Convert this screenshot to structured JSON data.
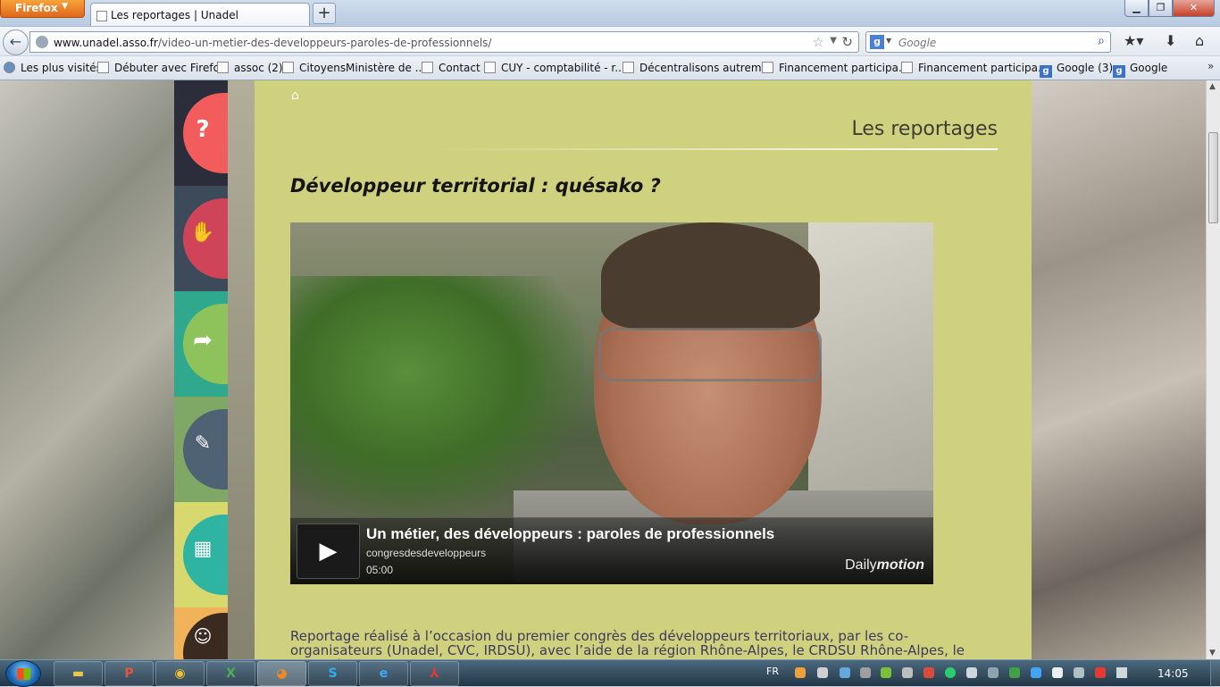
{
  "browser": {
    "app_button": "Firefox",
    "tab_title": "Les reportages | Unadel",
    "new_tab": "+",
    "url_host": "www.unadel.asso.fr",
    "url_path": "/video-un-metier-des-developpeurs-paroles-de-professionnels/",
    "search_placeholder": "Google"
  },
  "bookmarks": [
    {
      "label": "Les plus visités"
    },
    {
      "label": "Débuter avec Firefox"
    },
    {
      "label": "assoc (2)"
    },
    {
      "label": "Citoyens"
    },
    {
      "label": "Ministère de ..."
    },
    {
      "label": "Contact"
    },
    {
      "label": "CUY - comptabilité - r..."
    },
    {
      "label": "Décentralisons autrem..."
    },
    {
      "label": "Financement participa..."
    },
    {
      "label": "Financement participa..."
    },
    {
      "label": "Google (3)"
    },
    {
      "label": "Google"
    }
  ],
  "page": {
    "section_title": "Les reportages",
    "headline": "Développeur territorial : quésako ?",
    "video": {
      "title": "Un métier, des développeurs : paroles de professionnels",
      "channel": "congresdesdeveloppeurs",
      "duration": "05:00",
      "logo_prefix": "Daily",
      "logo_suffix": "motion"
    },
    "paragraph": "Reportage réalisé à l’occasion du premier congrès des développeurs territoriaux, par les co-organisateurs (Unadel, CVC, IRDSU), avec l’aide de la région Rhône-Alpes, le CRDSU Rhône-Alpes, le CRDR, le CIEDEL et"
  },
  "sidebar_tiles": [
    {
      "icon": "question-icon",
      "color": "#f25c5c"
    },
    {
      "icon": "handshake-icon",
      "color": "#d04459"
    },
    {
      "icon": "arrow-icon",
      "color": "#8ec25b"
    },
    {
      "icon": "document-icon",
      "color": "#4f6273"
    },
    {
      "icon": "calendar-icon",
      "color": "#2fb4a1"
    },
    {
      "icon": "people-icon",
      "color": "#3a2a20"
    }
  ],
  "taskbar": {
    "language": "FR",
    "time": "14:05"
  }
}
